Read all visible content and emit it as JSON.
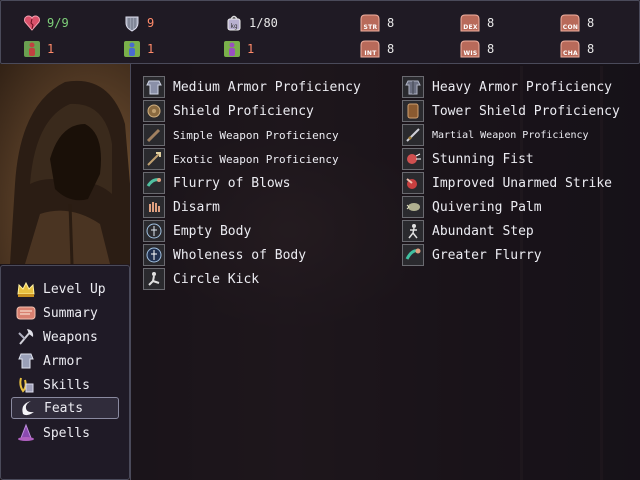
{
  "stats": {
    "hp": {
      "value": "9/9",
      "icon": "heart-icon"
    },
    "ac": {
      "value": "9",
      "icon": "shield-icon"
    },
    "weight": {
      "value": "1/80",
      "icon": "weight-icon"
    },
    "fort": {
      "value": "1",
      "icon": "body-green-icon"
    },
    "reflex": {
      "value": "1",
      "icon": "body-blue-icon"
    },
    "will": {
      "value": "1",
      "icon": "body-purple-icon"
    }
  },
  "attributes": [
    {
      "abbr": "STR",
      "value": "8"
    },
    {
      "abbr": "DEX",
      "value": "8"
    },
    {
      "abbr": "CON",
      "value": "8"
    },
    {
      "abbr": "INT",
      "value": "8"
    },
    {
      "abbr": "WIS",
      "value": "8"
    },
    {
      "abbr": "CHA",
      "value": "8"
    }
  ],
  "menu": [
    {
      "label": "Level Up",
      "icon": "crown-icon"
    },
    {
      "label": "Summary",
      "icon": "scroll-icon"
    },
    {
      "label": "Weapons",
      "icon": "axe-icon"
    },
    {
      "label": "Armor",
      "icon": "armor-icon"
    },
    {
      "label": "Skills",
      "icon": "skills-icon"
    },
    {
      "label": "Feats",
      "icon": "crescent-icon"
    },
    {
      "label": "Spells",
      "icon": "wizard-hat-icon"
    }
  ],
  "selected_menu": "Feats",
  "feats_left": [
    {
      "label": "Medium Armor Proficiency"
    },
    {
      "label": "Shield Proficiency"
    },
    {
      "label": "Simple Weapon Proficiency"
    },
    {
      "label": "Exotic Weapon Proficiency"
    },
    {
      "label": "Flurry of Blows"
    },
    {
      "label": "Disarm"
    },
    {
      "label": "Empty Body"
    },
    {
      "label": "Wholeness of Body"
    },
    {
      "label": "Circle Kick"
    }
  ],
  "feats_right": [
    {
      "label": "Heavy Armor Proficiency"
    },
    {
      "label": "Tower Shield Proficiency"
    },
    {
      "label": "Martial Weapon Proficiency"
    },
    {
      "label": "Stunning Fist"
    },
    {
      "label": "Improved Unarmed Strike"
    },
    {
      "label": "Quivering Palm"
    },
    {
      "label": "Abundant Step"
    },
    {
      "label": "Greater Flurry"
    }
  ]
}
